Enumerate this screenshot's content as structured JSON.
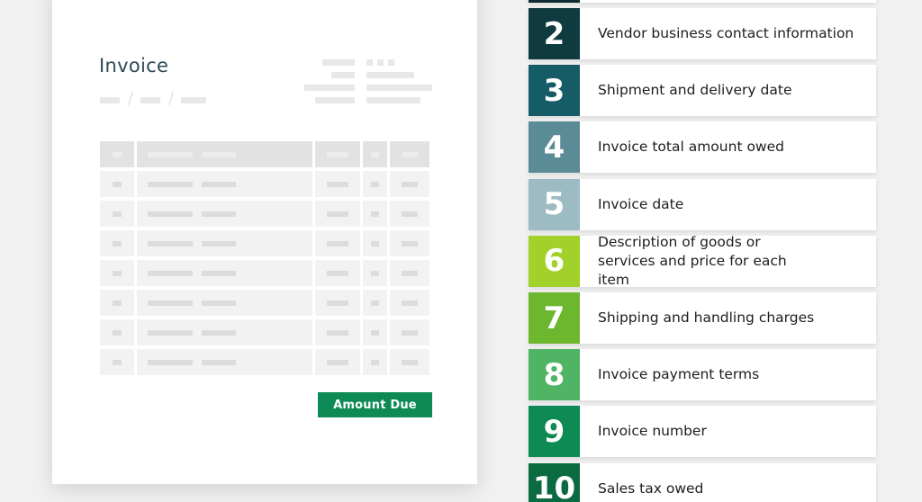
{
  "invoice": {
    "title": "Invoice",
    "amount_due_label": "Amount Due",
    "table_rows": 8
  },
  "legend": {
    "items": [
      {
        "number": "2",
        "label": "Vendor business contact information",
        "color": "#0f3a3f"
      },
      {
        "number": "3",
        "label": "Shipment and delivery date",
        "color": "#165c66"
      },
      {
        "number": "4",
        "label": "Invoice total amount owed",
        "color": "#5b8b96"
      },
      {
        "number": "5",
        "label": "Invoice date",
        "color": "#9dbbc3"
      },
      {
        "number": "6",
        "label": "Description of goods or services and price for each item",
        "color": "#a3d12c"
      },
      {
        "number": "7",
        "label": "Shipping and handling charges",
        "color": "#6db72e"
      },
      {
        "number": "8",
        "label": "Invoice payment terms",
        "color": "#4fb463"
      },
      {
        "number": "9",
        "label": "Invoice number",
        "color": "#0e8a55"
      },
      {
        "number": "10",
        "label": "Sales tax owed",
        "color": "#0a6b40"
      }
    ]
  },
  "colors": {
    "accent_green": "#0d8a56",
    "title_text": "#2c4a56"
  }
}
